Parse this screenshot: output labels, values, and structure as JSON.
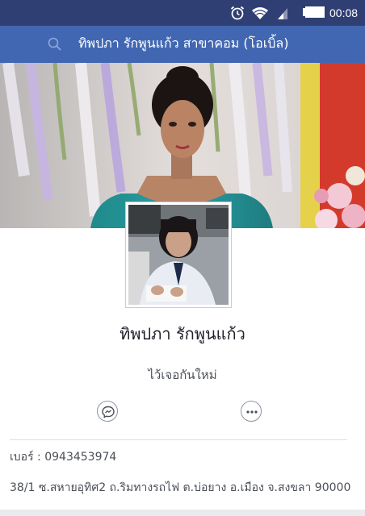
{
  "status_bar": {
    "time": "00:08",
    "icons": [
      "alarm-icon",
      "wifi-icon",
      "signal-icon",
      "battery-icon"
    ]
  },
  "header": {
    "search_text": "ทิพปภา รักพูนแก้ว สาขาคอม (โอเบิ้ล)",
    "icon": "search-icon"
  },
  "profile": {
    "name": "ทิพปภา รักพูนแก้ว",
    "bio": "ไว้เจอกันใหม่"
  },
  "actions": {
    "messenger_icon": "messenger-icon",
    "more_icon": "more-icon"
  },
  "info": {
    "phone": "เบอร์ : 0943453974",
    "address": "38/1 ซ.สหายอุทิศ2 ถ.ริมทางรถไฟ ต.บ่อยาง อ.เมือง จ.สงขลา 90000"
  },
  "colors": {
    "status_bar": "#2f3f73",
    "header": "#4267b2",
    "text_primary": "#1d2129",
    "text_secondary": "#4b4f56"
  }
}
